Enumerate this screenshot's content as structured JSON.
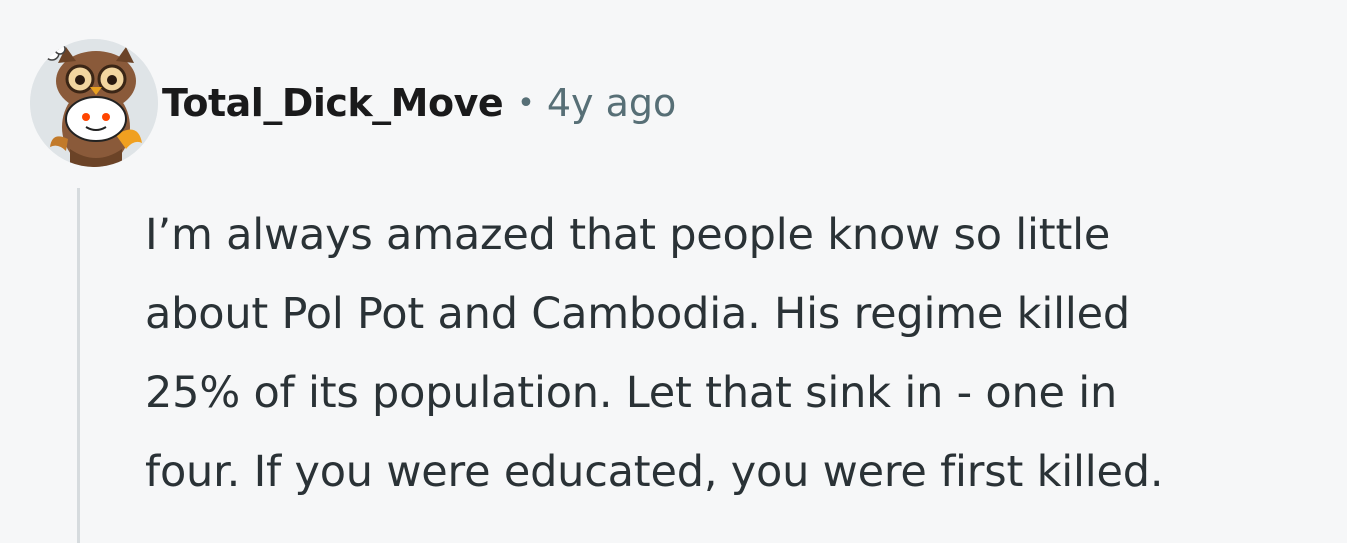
{
  "comment": {
    "author": "Total_Dick_Move",
    "separator": "•",
    "age": "4y ago",
    "avatar_icon": "owl-snoo-avatar-icon",
    "lines": [
      "I’m always amazed that people know so little",
      "about Pol Pot and Cambodia. His regime killed",
      "25% of its population. Let that sink in - one in",
      "four. If you were educated, you were first killed."
    ]
  },
  "colors": {
    "background": "#f6f7f8",
    "username": "#1a1a1b",
    "meta": "#576f76",
    "body": "#2a3236",
    "thread_line": "#d6dbde"
  }
}
